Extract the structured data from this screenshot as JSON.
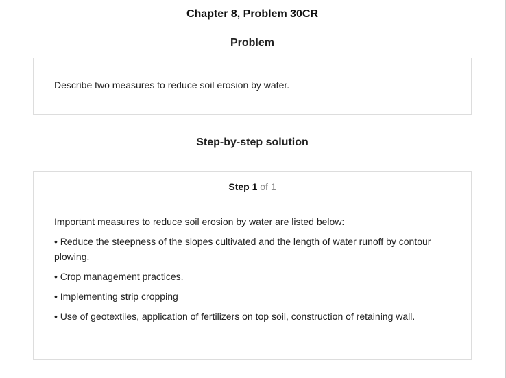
{
  "title": "Chapter 8, Problem 30CR",
  "problem": {
    "heading": "Problem",
    "text": "Describe two measures to reduce soil erosion by water."
  },
  "solution": {
    "heading": "Step-by-step solution",
    "step_label": "Step 1",
    "step_of": "of 1",
    "intro": "Important measures to reduce soil erosion by water are listed below:",
    "bullets": [
      "• Reduce the steepness of the slopes cultivated and the length of water runoff by contour plowing.",
      "• Crop management practices.",
      "• Implementing strip cropping",
      "• Use of geotextiles, application of fertilizers on top soil, construction of retaining wall."
    ]
  }
}
